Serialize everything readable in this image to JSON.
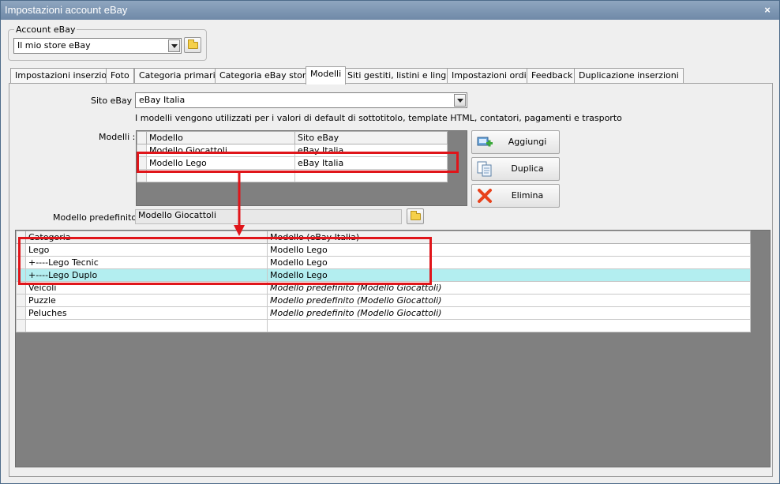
{
  "window": {
    "title": "Impostazioni account eBay",
    "close_glyph": "×"
  },
  "account": {
    "legend": "Account eBay",
    "selected": "Il mio store eBay"
  },
  "tabs": [
    "Impostazioni inserzioni",
    "Foto",
    "Categoria primaria",
    "Categoria eBay store",
    "Modelli",
    "Siti gestiti, listini e lingue",
    "Impostazioni ordini",
    "Feedback",
    "Duplicazione inserzioni"
  ],
  "active_tab": "Modelli",
  "site": {
    "label": "Sito eBay :",
    "selected": "eBay Italia",
    "info": "I modelli vengono utilizzati per i valori di default di sottotitolo, template HTML, contatori, pagamenti e trasporto"
  },
  "models": {
    "label": "Modelli :",
    "columns": [
      "Modello",
      "Sito eBay"
    ],
    "rows": [
      [
        "Modello Giocattoli",
        "eBay Italia"
      ],
      [
        "Modello Lego",
        "eBay Italia"
      ]
    ]
  },
  "buttons": {
    "add": "Aggiungi",
    "duplicate": "Duplica",
    "delete": "Elimina"
  },
  "default_model": {
    "label": "Modello predefinito :",
    "value": "Modello Giocattoli"
  },
  "categories": {
    "columns": [
      "Categoria",
      "Modello (eBay Italia)"
    ],
    "rows": [
      [
        "Lego",
        "Modello Lego"
      ],
      [
        "+----Lego Tecnic",
        "Modello Lego"
      ],
      [
        "+----Lego Duplo",
        "Modello Lego"
      ],
      [
        "Veicoli",
        "Modello predefinito (Modello Giocattoli)"
      ],
      [
        "Puzzle",
        "Modello predefinito (Modello Giocattoli)"
      ],
      [
        "Peluches",
        "Modello predefinito (Modello Giocattoli)"
      ]
    ],
    "highlighted_row": "+----Lego Duplo",
    "highlight_color": "#b3eef0"
  },
  "annotation_color": "#e0151a",
  "icons": {
    "folder": "folder-icon",
    "add": "add-model-icon",
    "duplicate": "duplicate-icon",
    "delete": "delete-x-icon",
    "dropdown": "chevron-down-icon"
  }
}
